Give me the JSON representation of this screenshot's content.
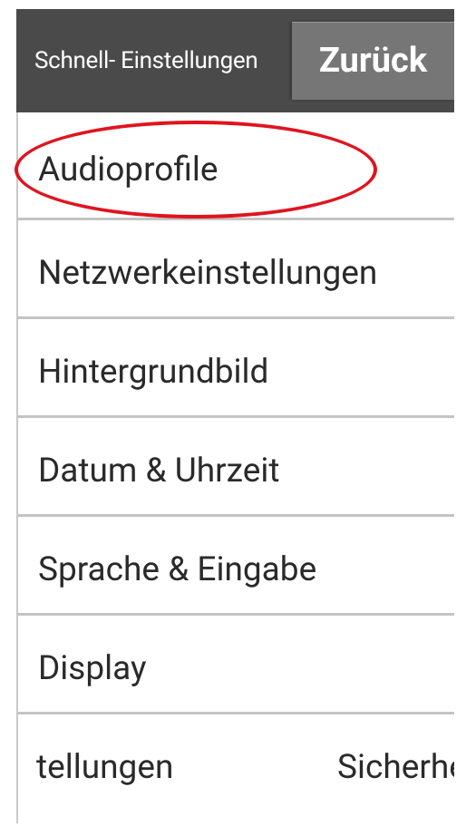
{
  "header": {
    "title": "Schnell- Einstellungen",
    "back_label": "Zurück"
  },
  "menu": {
    "items": [
      {
        "label": "Audioprofile"
      },
      {
        "label": "Netzwerkeinstellungen"
      },
      {
        "label": "Hintergrundbild"
      },
      {
        "label": "Datum & Uhrzeit"
      },
      {
        "label": "Sprache & Eingabe"
      },
      {
        "label": "Display"
      }
    ],
    "partial_row": {
      "left_label": "tellungen",
      "right_label": "Sicherheit"
    }
  },
  "annotation": {
    "highlight_color": "#e0141e",
    "highlighted_item": "Audioprofile"
  }
}
